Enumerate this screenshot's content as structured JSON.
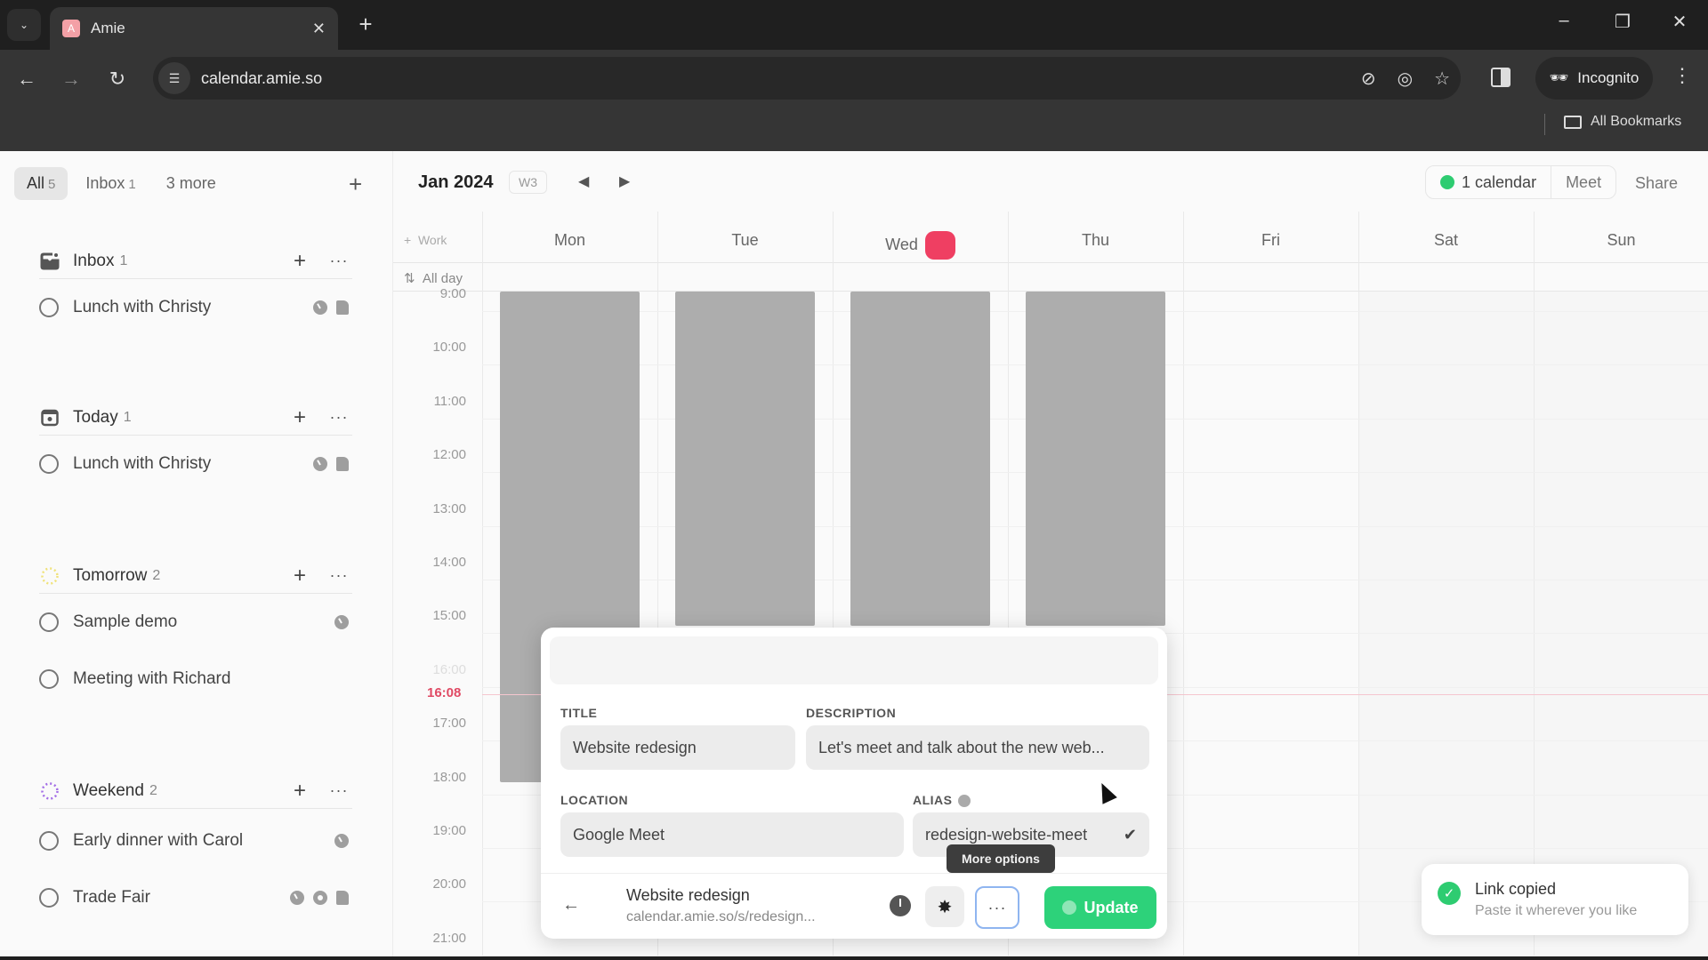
{
  "browser": {
    "tab_title": "Amie",
    "url": "calendar.amie.so",
    "incognito_label": "Incognito",
    "bookmarks_label": "All Bookmarks"
  },
  "sidebar": {
    "tabs": [
      {
        "label": "All",
        "count": "5",
        "active": true
      },
      {
        "label": "Inbox",
        "count": "1",
        "active": false
      },
      {
        "label": "3 more",
        "count": "",
        "active": false
      }
    ],
    "groups": [
      {
        "name": "Inbox",
        "count": "1",
        "icon": "inbox-icon",
        "items": [
          {
            "name": "Lunch with Christy",
            "meta": [
              "clock-icon",
              "note-icon"
            ]
          }
        ]
      },
      {
        "name": "Today",
        "count": "1",
        "icon": "today-icon",
        "items": [
          {
            "name": "Lunch with Christy",
            "meta": [
              "clock-icon",
              "note-icon"
            ]
          }
        ]
      },
      {
        "name": "Tomorrow",
        "count": "2",
        "icon": "tomorrow-icon",
        "items": [
          {
            "name": "Sample demo",
            "meta": [
              "clock-icon"
            ]
          },
          {
            "name": "Meeting with Richard",
            "meta": []
          }
        ]
      },
      {
        "name": "Weekend",
        "count": "2",
        "icon": "weekend-icon",
        "items": [
          {
            "name": "Early dinner with Carol",
            "meta": [
              "clock-icon"
            ]
          },
          {
            "name": "Trade Fair",
            "meta": [
              "clock-icon",
              "location-icon",
              "note-icon"
            ]
          }
        ]
      }
    ]
  },
  "calendar": {
    "month": "Jan 2024",
    "week": "W3",
    "calendars_label": "1 calendar",
    "meet_label": "Meet",
    "share_label": "Share",
    "work_label": "Work",
    "allday_label": "All day",
    "days": [
      "Mon",
      "Tue",
      "Wed",
      "Thu",
      "Fri",
      "Sat",
      "Sun"
    ],
    "today_index": 2,
    "hours": [
      "9:00",
      "10:00",
      "11:00",
      "12:00",
      "13:00",
      "14:00",
      "15:00",
      "16:00",
      "17:00",
      "18:00",
      "19:00",
      "20:00",
      "21:00"
    ],
    "now_label": "16:08",
    "colors": {
      "today": "#ef3f62",
      "now": "#e04a64",
      "calendar_dot": "#2ecc71",
      "update": "#2dd27a"
    }
  },
  "popover": {
    "title_label": "TITLE",
    "title_value": "Website redesign",
    "description_label": "DESCRIPTION",
    "description_value": "Let's meet and talk about the new web...",
    "location_label": "LOCATION",
    "location_value": "Google Meet",
    "alias_label": "ALIAS",
    "alias_value": "redesign-website-meet",
    "footer_title": "Website redesign",
    "footer_url": "calendar.amie.so/s/redesign...",
    "update_label": "Update",
    "tooltip": "More options"
  },
  "toast": {
    "title": "Link copied",
    "subtitle": "Paste it wherever you like"
  }
}
